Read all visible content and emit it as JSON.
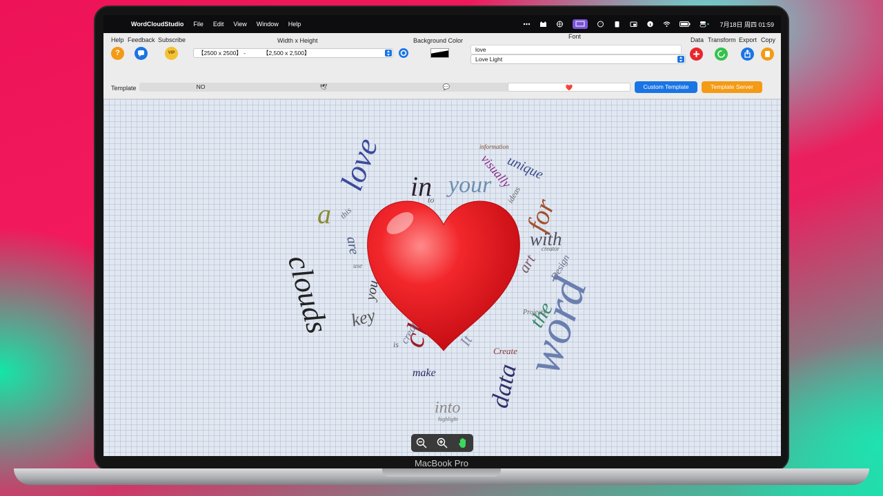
{
  "menubar": {
    "app_name": "WordCloudStudio",
    "menus": [
      "File",
      "Edit",
      "View",
      "Window",
      "Help"
    ],
    "clock": "7月18日 周四  01:59"
  },
  "toolbar": {
    "help_label": "Help",
    "feedback_label": "Feedback",
    "subscribe_label": "Subscribe",
    "vip_badge": "VIP",
    "size_label": "Width  x  Height",
    "size_value_left": "【2500 x 2500】  -",
    "size_value_right": "【2,500 x 2,500】",
    "bg_color_label": "Background Color",
    "font_label": "Font",
    "font_text_value": "love",
    "font_name_value": "Love Light",
    "data_label": "Data",
    "transform_label": "Transform",
    "export_label": "Export",
    "copy_label": "Copy",
    "help_glyph": "?"
  },
  "template": {
    "label": "Template",
    "options": [
      "NO",
      "🕊",
      "💬",
      "❤️"
    ],
    "custom_button": "Custom Template",
    "server_button": "Template Server"
  },
  "wordcloud_words": [
    "love",
    "in",
    "your",
    "for",
    "with",
    "word",
    "clouds",
    "a",
    "cloud",
    "are",
    "data",
    "into",
    "make",
    "key",
    "the",
    "art",
    "Design",
    "unique",
    "visually",
    "information",
    "ideas",
    "Create",
    "Projects",
    "you",
    "creator",
    "highlight",
    "use",
    "create",
    "this",
    "to",
    "It",
    "is"
  ],
  "colors": {
    "accent_blue": "#1b74e4",
    "orange": "#f49a14",
    "red": "#e8262b",
    "green": "#33c24d"
  },
  "device_label": "MacBook Pro"
}
